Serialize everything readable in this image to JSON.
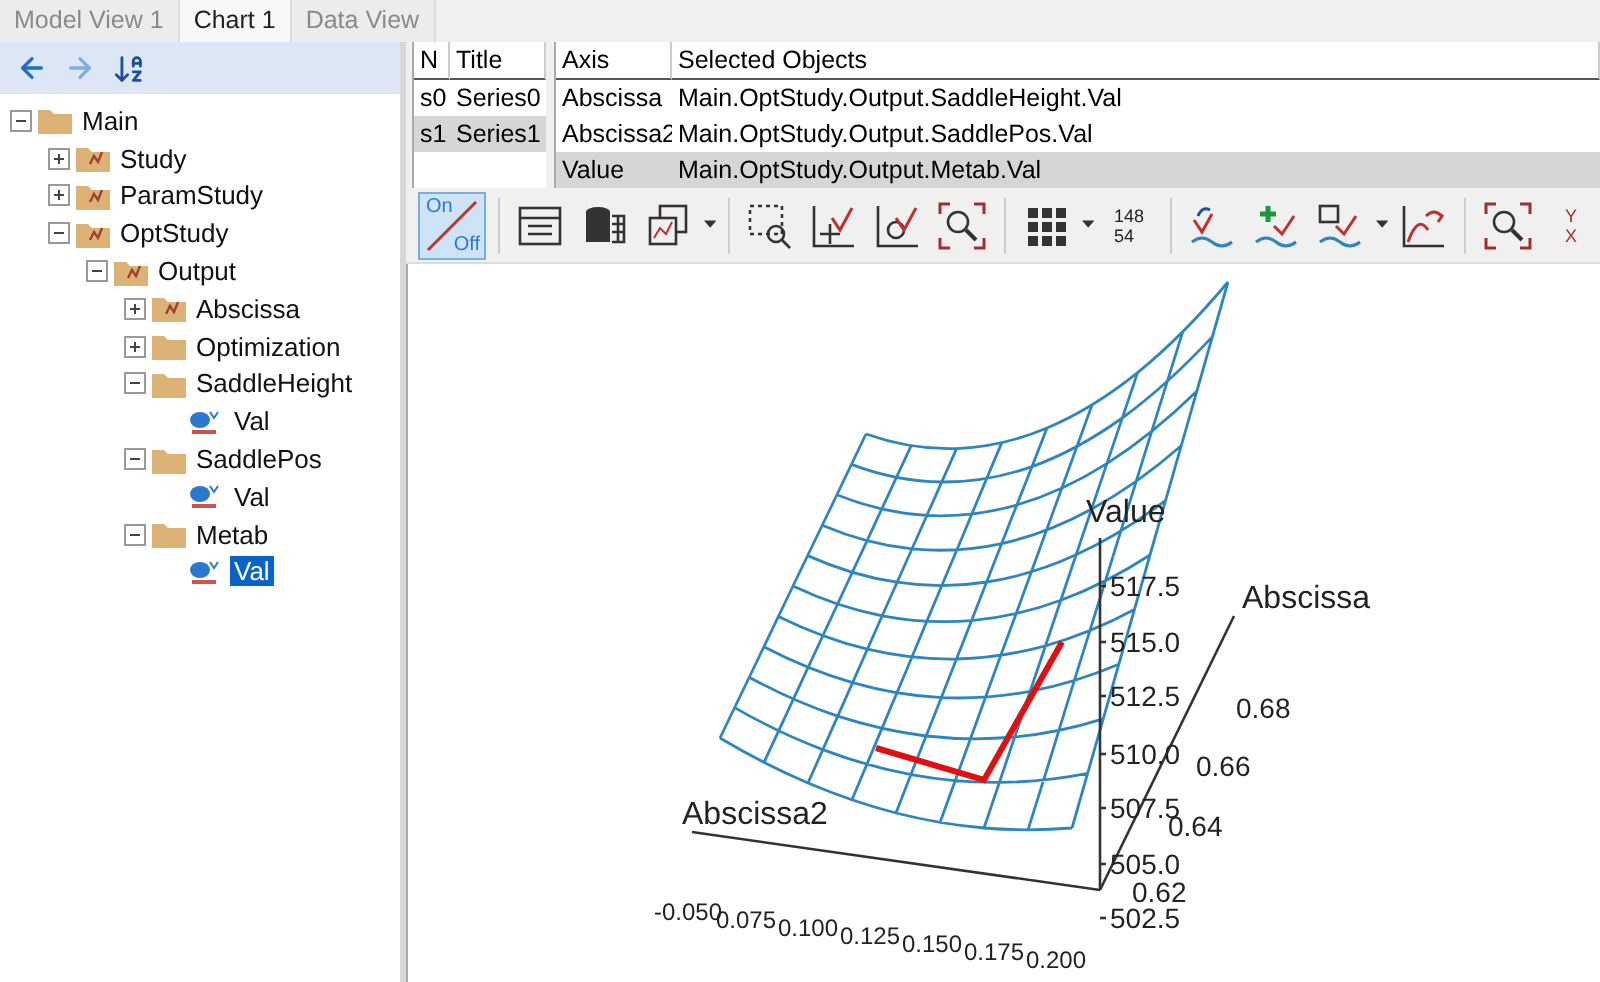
{
  "tabs": [
    {
      "label": "Model View 1",
      "selected": false
    },
    {
      "label": "Chart 1",
      "selected": true
    },
    {
      "label": "Data View",
      "selected": false
    }
  ],
  "tree": [
    {
      "label": "Main",
      "kind": "folder",
      "expanded": true,
      "selected": false,
      "children": [
        {
          "label": "Study",
          "kind": "study",
          "expanded": false,
          "selected": false
        },
        {
          "label": "ParamStudy",
          "kind": "study",
          "expanded": false,
          "selected": false
        },
        {
          "label": "OptStudy",
          "kind": "study",
          "expanded": true,
          "selected": false,
          "children": [
            {
              "label": "Output",
              "kind": "study",
              "expanded": true,
              "selected": false,
              "children": [
                {
                  "label": "Abscissa",
                  "kind": "study",
                  "expanded": false,
                  "selected": false
                },
                {
                  "label": "Optimization",
                  "kind": "folder",
                  "expanded": false,
                  "selected": false
                },
                {
                  "label": "SaddleHeight",
                  "kind": "folder",
                  "expanded": true,
                  "selected": false,
                  "children": [
                    {
                      "label": "Val",
                      "kind": "variable",
                      "selected": false
                    }
                  ]
                },
                {
                  "label": "SaddlePos",
                  "kind": "folder",
                  "expanded": true,
                  "selected": false,
                  "children": [
                    {
                      "label": "Val",
                      "kind": "variable",
                      "selected": false
                    }
                  ]
                },
                {
                  "label": "Metab",
                  "kind": "folder",
                  "expanded": true,
                  "selected": false,
                  "children": [
                    {
                      "label": "Val",
                      "kind": "variable",
                      "selected": true
                    }
                  ]
                }
              ]
            }
          ]
        }
      ]
    }
  ],
  "series_table": {
    "columns": [
      "N",
      "Title"
    ],
    "rows": [
      {
        "cells": [
          "s0",
          "Series0"
        ],
        "selected": false
      },
      {
        "cells": [
          "s1",
          "Series1"
        ],
        "selected": true
      }
    ]
  },
  "axis_table": {
    "columns": [
      "Axis",
      "Selected Objects"
    ],
    "rows": [
      {
        "cells": [
          "Abscissa",
          "Main.OptStudy.Output.SaddleHeight.Val"
        ],
        "selected": false
      },
      {
        "cells": [
          "Abscissa2",
          "Main.OptStudy.Output.SaddlePos.Val"
        ],
        "selected": false
      },
      {
        "cells": [
          "Value",
          "Main.OptStudy.Output.Metab.Val"
        ],
        "selected": true
      }
    ]
  },
  "toolbar": {
    "onoff": {
      "on": "On",
      "off": "Off",
      "selected": true
    },
    "labels_button": [
      "148",
      "54"
    ],
    "axis_button": [
      "Y",
      "X"
    ]
  },
  "chart": {
    "axes": [
      {
        "title": "Value",
        "ticks": [
          "517.5",
          "515.0",
          "512.5",
          "510.0",
          "507.5",
          "505.0",
          "502.5"
        ]
      },
      {
        "title": "Abscissa",
        "ticks": [
          "0.68",
          "0.66",
          "0.64",
          "0.62"
        ]
      },
      {
        "title": "Abscissa2",
        "ticks": [
          "-0.050",
          "0.075",
          "0.100",
          "0.125",
          "0.150",
          "0.175",
          "0.200"
        ]
      }
    ]
  }
}
